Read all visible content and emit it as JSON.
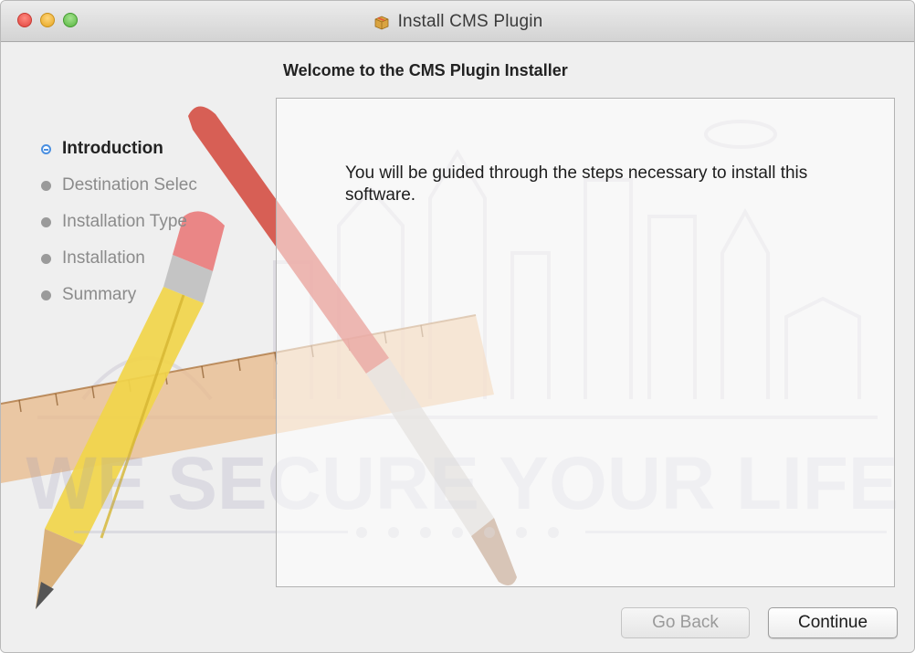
{
  "window": {
    "title": "Install CMS Plugin",
    "title_icon": "package-icon"
  },
  "main": {
    "heading": "Welcome to the CMS Plugin Installer",
    "body": "You will be guided through the steps necessary to install this software."
  },
  "sidebar": {
    "steps": [
      {
        "label": "Introduction",
        "active": true
      },
      {
        "label": "Destination Selec",
        "active": false
      },
      {
        "label": "Installation Type",
        "active": false
      },
      {
        "label": "Installation",
        "active": false
      },
      {
        "label": "Summary",
        "active": false
      }
    ]
  },
  "footer": {
    "back_label": "Go Back",
    "back_enabled": false,
    "continue_label": "Continue"
  },
  "watermark": {
    "text": "WE SECURE YOUR LIFE"
  },
  "colors": {
    "active_step_bullet": "#4a8fe0",
    "window_background": "#ececec"
  }
}
